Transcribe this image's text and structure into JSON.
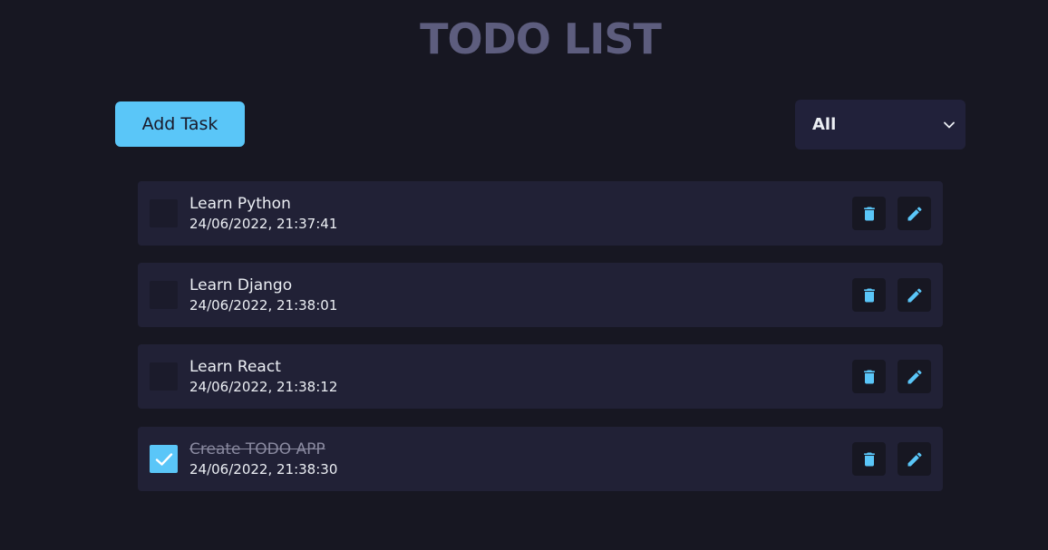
{
  "app": {
    "title": "TODO LIST"
  },
  "toolbar": {
    "add_label": "Add Task",
    "filter": {
      "selected": "All"
    }
  },
  "tasks": [
    {
      "title": "Learn Python",
      "time": "24/06/2022, 21:37:41",
      "completed": false
    },
    {
      "title": "Learn Django",
      "time": "24/06/2022, 21:38:01",
      "completed": false
    },
    {
      "title": "Learn React",
      "time": "24/06/2022, 21:38:12",
      "completed": false
    },
    {
      "title": "Create TODO APP",
      "time": "24/06/2022, 21:38:30",
      "completed": true
    }
  ],
  "colors": {
    "background": "#171722",
    "accent": "#5ac6f8",
    "card": "#212136",
    "title": "#5d5d7e",
    "text": "#eceff4"
  },
  "icons": {
    "delete": "trash-icon",
    "edit": "pencil-icon",
    "check": "checkmark-icon",
    "dropdown": "chevron-down-icon"
  }
}
